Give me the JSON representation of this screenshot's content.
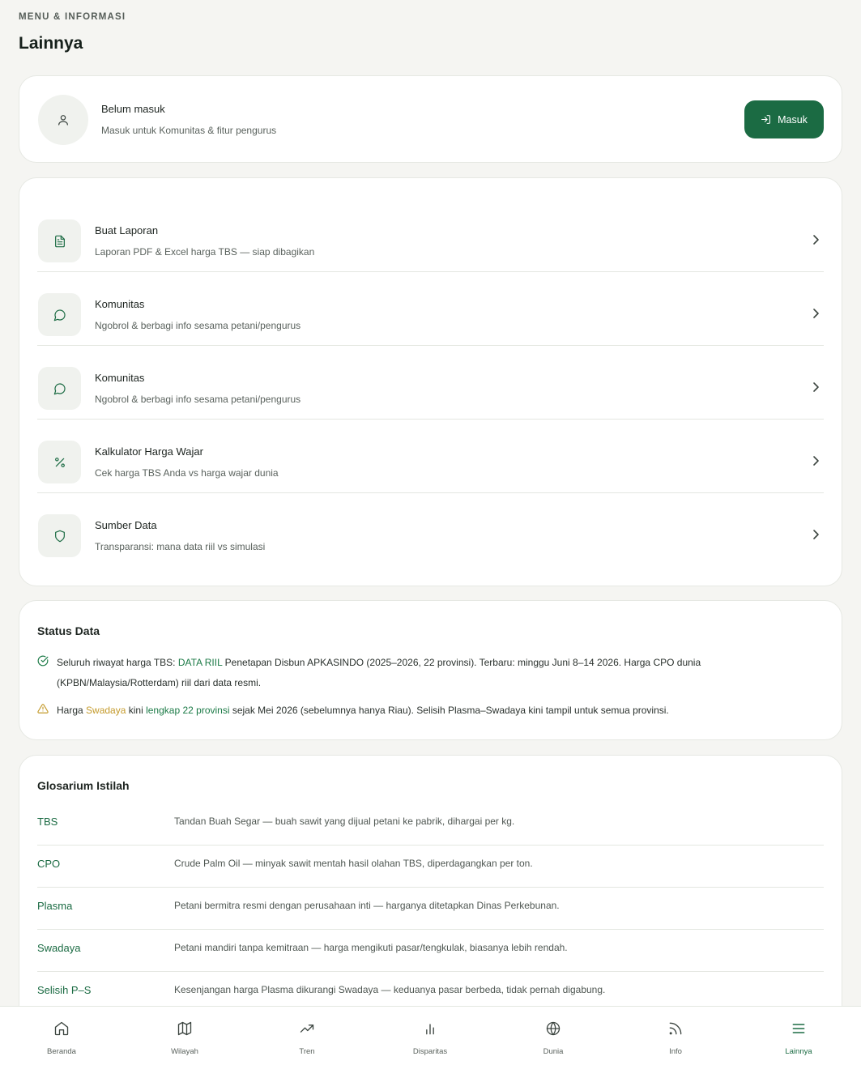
{
  "header": {
    "eyebrow": "MENU & INFORMASI",
    "title": "Lainnya"
  },
  "account": {
    "title": "Belum masuk",
    "subtitle": "Masuk untuk Komunitas & fitur pengurus",
    "login_label": "Masuk"
  },
  "menu": {
    "items": [
      {
        "title": "Buat Laporan",
        "subtitle": "Laporan PDF & Excel harga TBS — siap dibagikan",
        "icon": "document-icon"
      },
      {
        "title": "Komunitas",
        "subtitle": "Ngobrol & berbagi info sesama petani/pengurus",
        "icon": "chat-icon"
      },
      {
        "title": "Komunitas",
        "subtitle": "Ngobrol & berbagi info sesama petani/pengurus",
        "icon": "chat-icon"
      },
      {
        "title": "Kalkulator Harga Wajar",
        "subtitle": "Cek harga TBS Anda vs harga wajar dunia",
        "icon": "percent-icon"
      },
      {
        "title": "Sumber Data",
        "subtitle": "Transparansi: mana data riil vs simulasi",
        "icon": "shield-icon"
      }
    ]
  },
  "status": {
    "title": "Status Data",
    "line1": {
      "prefix": "Seluruh riwayat harga TBS: ",
      "highlight": "DATA RIIL",
      "rest1": " Penetapan Disbun APKASINDO (2025–2026, 22 provinsi). Terbaru: minggu Juni 8–14 2026. Harga CPO dunia",
      "rest2": "(KPBN/Malaysia/Rotterdam) riil dari data resmi."
    },
    "line2": {
      "prefix": "Harga ",
      "highlight_amber": "Swadaya",
      "middle": " kini ",
      "highlight_green": "lengkap 22 provinsi",
      "rest": " sejak Mei 2026 (sebelumnya hanya Riau). Selisih Plasma–Swadaya kini tampil untuk semua provinsi."
    }
  },
  "glossary": {
    "title": "Glosarium Istilah",
    "items": [
      {
        "term": "TBS",
        "definition": "Tandan Buah Segar — buah sawit yang dijual petani ke pabrik, dihargai per kg."
      },
      {
        "term": "CPO",
        "definition": "Crude Palm Oil — minyak sawit mentah hasil olahan TBS, diperdagangkan per ton."
      },
      {
        "term": "Plasma",
        "definition": "Petani bermitra resmi dengan perusahaan inti — harganya ditetapkan Dinas Perkebunan."
      },
      {
        "term": "Swadaya",
        "definition": "Petani mandiri tanpa kemitraan — harga mengikuti pasar/tengkulak, biasanya lebih rendah."
      },
      {
        "term": "Selisih P–S",
        "definition": "Kesenjangan harga Plasma dikurangi Swadaya — keduanya pasar berbeda, tidak pernah digabung."
      }
    ]
  },
  "nav": {
    "items": [
      {
        "label": "Beranda",
        "icon": "home-icon"
      },
      {
        "label": "Wilayah",
        "icon": "map-icon"
      },
      {
        "label": "Tren",
        "icon": "trending-up-icon"
      },
      {
        "label": "Disparitas",
        "icon": "bar-chart-icon"
      },
      {
        "label": "Dunia",
        "icon": "globe-icon"
      },
      {
        "label": "Info",
        "icon": "rss-icon"
      },
      {
        "label": "Lainnya",
        "icon": "menu-icon"
      }
    ],
    "active": "Lainnya"
  },
  "colors": {
    "accent": "#1b6b43",
    "accent_text": "#1b7a46",
    "warning": "#c49a2b",
    "background": "#f5f5f2"
  }
}
